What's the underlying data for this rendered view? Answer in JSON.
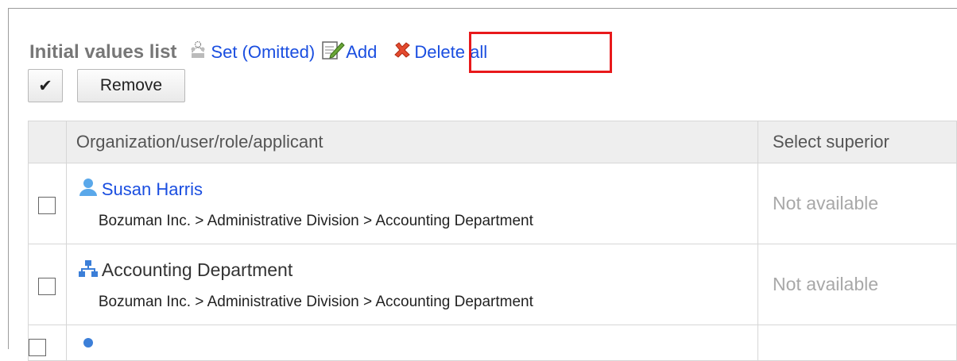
{
  "header": {
    "title": "Initial values list",
    "set_label": "Set (Omitted)",
    "add_label": "Add",
    "delete_all_label": "Delete all"
  },
  "toolbar": {
    "check_label": "✔",
    "remove_label": "Remove"
  },
  "table": {
    "columns": [
      "Organization/user/role/applicant",
      "Select superior"
    ],
    "rows": [
      {
        "type": "user-icon",
        "name": "Susan Harris",
        "path": "Bozuman Inc. > Administrative Division > Accounting Department",
        "superior": "Not available"
      },
      {
        "type": "organization-icon",
        "name": "Accounting Department",
        "path": "Bozuman Inc. > Administrative Division > Accounting Department",
        "superior": "Not available"
      }
    ]
  },
  "colors": {
    "link": "#1a4ee0",
    "highlight": "#e8191b",
    "header_bg": "#eeeeee"
  }
}
